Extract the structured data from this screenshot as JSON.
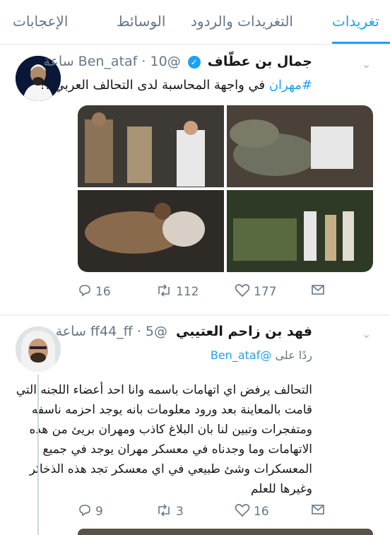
{
  "tabs": [
    {
      "label": "تغريدات"
    },
    {
      "label": "التغريدات والردود"
    },
    {
      "label": "الوسائط"
    },
    {
      "label": "الإعجابات"
    }
  ],
  "tweet1": {
    "name": "جمال بن عطّاف",
    "handle": "@Ben_ataf",
    "time": "10 ساعة",
    "hashtag": "#مهران",
    "text_rest": " في واجهة المحاسبة لدى التحالف العربي !!",
    "replies": "16",
    "retweets": "112",
    "likes": "177"
  },
  "tweet2": {
    "name": "فهد بن زاحم العتيبي",
    "handle": "@ff44_ff",
    "time": "5 ساعة",
    "reply_to_prefix": "ردًا على",
    "reply_to_handle": "@Ben_ataf",
    "text": "التحالف يرفض اي اتهامات باسمه وانا احد أعضاء اللجنه التي قامت بالمعاينة بعد ورود معلومات بانه يوجد احزمه ناسفه ومتفجرات وتبين لنا بان البلاغ كاذب ومهران بريئ من هذه الاتهامات وما وجدناه في معسكر مهران يوجد في جميع المعسكرات وشئ طبيعي في اي معسكر تجد هذه الذخائر وغيرها للعلم",
    "replies": "9",
    "retweets": "3",
    "likes": "16"
  },
  "icons": {
    "reply": "reply-icon",
    "retweet": "retweet-icon",
    "like": "heart-icon",
    "dm": "envelope-icon",
    "verified": "verified-badge-icon",
    "chevron": "chevron-down-icon"
  },
  "colors": {
    "accent": "#1da1f2",
    "secondary_text": "#657786",
    "divider": "#e1e8ed"
  }
}
